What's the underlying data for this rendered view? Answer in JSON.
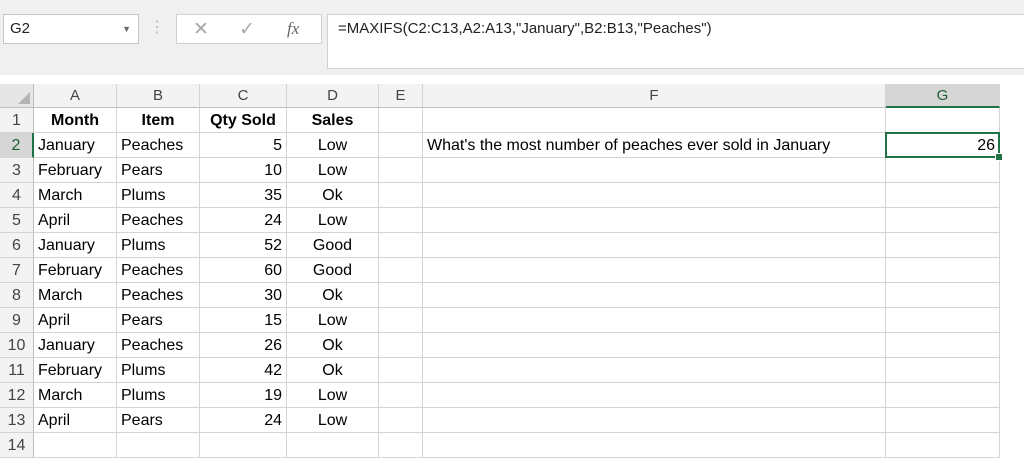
{
  "name_box": {
    "value": "G2"
  },
  "formula_bar": {
    "cancel_icon": "close-icon",
    "enter_icon": "check-icon",
    "function_label": "fx",
    "formula": "=MAXIFS(C2:C13,A2:A13,\"January\",B2:B13,\"Peaches\")"
  },
  "columns": [
    "A",
    "B",
    "C",
    "D",
    "E",
    "F",
    "G"
  ],
  "selected_column": "G",
  "rows": [
    "1",
    "2",
    "3",
    "4",
    "5",
    "6",
    "7",
    "8",
    "9",
    "10",
    "11",
    "12",
    "13",
    "14"
  ],
  "selected_row": "2",
  "headers": {
    "month": "Month",
    "item": "Item",
    "qty": "Qty Sold",
    "sales": "Sales"
  },
  "data": [
    {
      "month": "January",
      "item": "Peaches",
      "qty": "5",
      "sales": "Low"
    },
    {
      "month": "February",
      "item": "Pears",
      "qty": "10",
      "sales": "Low"
    },
    {
      "month": "March",
      "item": "Plums",
      "qty": "35",
      "sales": "Ok"
    },
    {
      "month": "April",
      "item": "Peaches",
      "qty": "24",
      "sales": "Low"
    },
    {
      "month": "January",
      "item": "Plums",
      "qty": "52",
      "sales": "Good"
    },
    {
      "month": "February",
      "item": "Peaches",
      "qty": "60",
      "sales": "Good"
    },
    {
      "month": "March",
      "item": "Peaches",
      "qty": "30",
      "sales": "Ok"
    },
    {
      "month": "April",
      "item": "Pears",
      "qty": "15",
      "sales": "Low"
    },
    {
      "month": "January",
      "item": "Peaches",
      "qty": "26",
      "sales": "Ok"
    },
    {
      "month": "February",
      "item": "Plums",
      "qty": "42",
      "sales": "Ok"
    },
    {
      "month": "March",
      "item": "Plums",
      "qty": "19",
      "sales": "Low"
    },
    {
      "month": "April",
      "item": "Pears",
      "qty": "24",
      "sales": "Low"
    }
  ],
  "question": {
    "text": "What's the most number of peaches ever sold in January",
    "result": "26"
  },
  "colors": {
    "accent": "#217346",
    "gridline": "#d4d4d4"
  }
}
